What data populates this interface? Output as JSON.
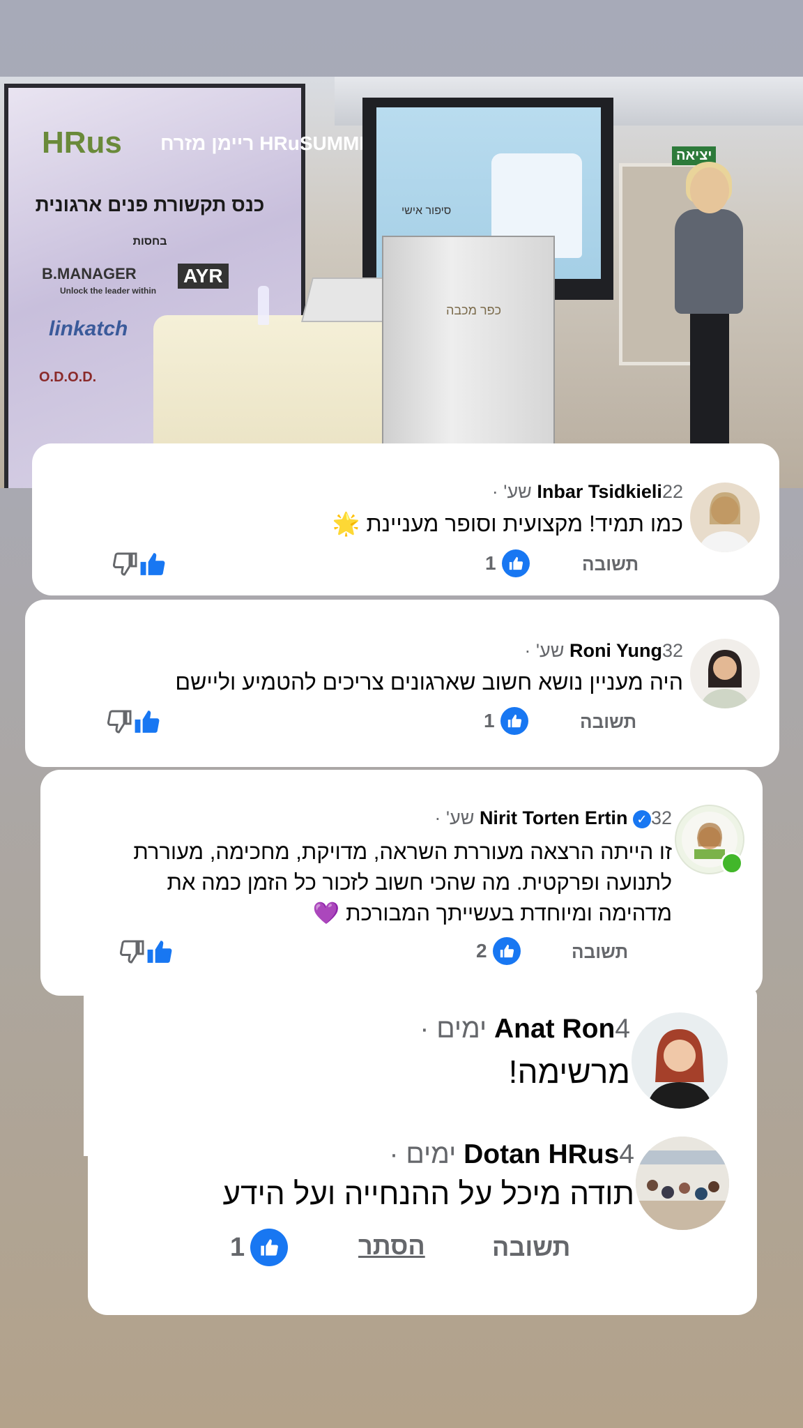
{
  "photo": {
    "banner_logo": "HRus",
    "banner_summit": "ריימן מזרח HRuSUMMIT",
    "banner_title": "כנס תקשורת פנים ארגונית",
    "banner_subtitle": "בחסות",
    "sponsors": [
      "B.MANAGER",
      "Unlock the leader within",
      "AYR",
      "linkatch",
      "O.D.O.D."
    ],
    "screen_text": "סיפור אישי",
    "podium_text": "כפר מכבה",
    "exit_sign": "יציאה"
  },
  "comments": [
    {
      "name": "Inbar Tsidkieli",
      "time": "22 שע'",
      "text": "כמו תמיד! מקצועית וסופר מעניינת",
      "emoji": "🌟",
      "likes": "1",
      "reply_label": "תשובה"
    },
    {
      "name": "Roni Yung",
      "time": "32 שע'",
      "text": "היה מעניין נושא חשוב שארגונים צריכים להטמיע וליישם",
      "likes": "1",
      "reply_label": "תשובה"
    },
    {
      "name": "Nirit Torten Ertin",
      "time": "32 שע'",
      "text_lines": [
        "זו הייתה הרצאה מעוררת השראה, מדויקת, מחכימה, מעוררת",
        "לתנועה ופרקטית. מה שהכי חשוב לזכור כל הזמן כמה את",
        "מדהימה ומיוחדת בעשייתך המבורכת"
      ],
      "emoji": "💜",
      "likes": "2",
      "reply_label": "תשובה"
    },
    {
      "name": "Anat Ron",
      "time": "4 ימים",
      "text": "מרשימה!"
    },
    {
      "name": "Dotan HRus",
      "time": "4 ימים",
      "text": "תודה מיכל על ההנחייה ועל הידע",
      "likes": "1",
      "reply_label": "תשובה",
      "hide_label": "הסתר"
    }
  ],
  "colors": {
    "like_blue": "#1877f2",
    "secondary_text": "#65676b",
    "primary_text": "#050505",
    "online_green": "#42b72a"
  }
}
